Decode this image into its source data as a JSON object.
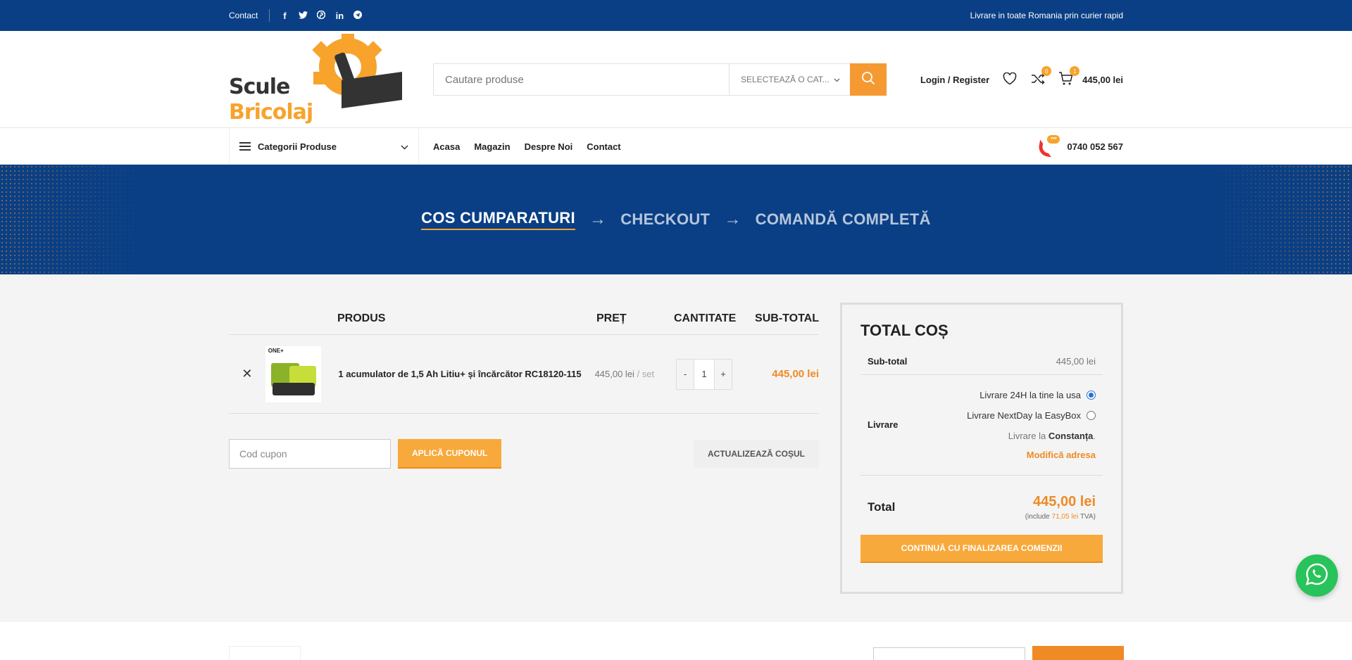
{
  "topbar": {
    "contact": "Contact",
    "social": [
      "facebook-icon",
      "twitter-icon",
      "pinterest-icon",
      "linkedin-icon",
      "telegram-icon"
    ],
    "shipping_note": "Livrare in toate Romania prin curier rapid"
  },
  "logo": {
    "line1": "Scule",
    "line2": "Bricolaj"
  },
  "search": {
    "placeholder": "Cautare produse",
    "category": "SELECTEAZĂ O CAT..."
  },
  "header": {
    "login": "Login / Register",
    "compare_count": "0",
    "cart_count": "1",
    "cart_total": "445,00 lei"
  },
  "nav": {
    "categories": "Categorii Produse",
    "items": [
      "Acasa",
      "Magazin",
      "Despre Noi",
      "Contact"
    ],
    "phone": "0740 052 567"
  },
  "steps": {
    "s1": "COS CUMPARATURI",
    "s2": "CHECKOUT",
    "s3": "COMANDĂ COMPLETĂ"
  },
  "cart": {
    "headers": {
      "product": "PRODUS",
      "price": "PREȚ",
      "qty": "CANTITATE",
      "subtotal": "SUB-TOTAL"
    },
    "items": [
      {
        "name": "1 acumulator de 1,5 Ah Litiu+ și încărcător RC18120-115",
        "price": "445,00 lei",
        "unit": "/ set",
        "qty": "1",
        "subtotal": "445,00 lei",
        "thumb_label": "ONE+"
      }
    ],
    "coupon_placeholder": "Cod cupon",
    "apply_coupon": "APLICĂ CUPONUL",
    "update_cart": "ACTUALIZEAZĂ COȘUL"
  },
  "totals": {
    "title": "TOTAL COȘ",
    "subtotal_label": "Sub-total",
    "subtotal_value": "445,00 lei",
    "shipping_label": "Livrare",
    "shipping_options": [
      {
        "label": "Livrare 24H la tine la usa",
        "selected": true
      },
      {
        "label": "Livrare NextDay la EasyBox",
        "selected": false
      }
    ],
    "shipping_dest_prefix": "Livrare la",
    "shipping_dest": "Constanța",
    "change_address": "Modifică adresa",
    "total_label": "Total",
    "total_value": "445,00 lei",
    "tax_prefix": "(include",
    "tax_value": "71,05 lei",
    "tax_suffix": "TVA)",
    "checkout": "CONTINUĂ CU FINALIZAREA COMENZII"
  },
  "colors": {
    "primary_blue": "#0a3f85",
    "accent_orange": "#f7a32c",
    "whatsapp_green": "#28c35a"
  }
}
